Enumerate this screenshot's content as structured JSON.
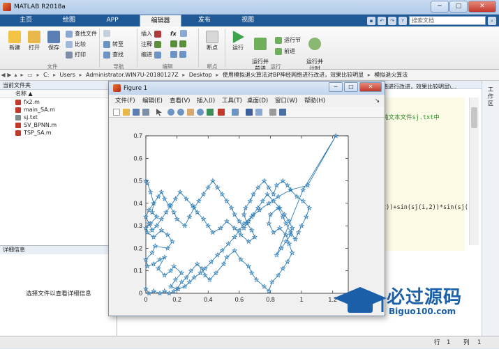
{
  "window": {
    "title": "MATLAB R2018a",
    "minimize": "─",
    "maximize": "□",
    "close": "✕"
  },
  "tabs": [
    "主页",
    "绘图",
    "APP",
    "编辑器",
    "发布",
    "视图"
  ],
  "search_placeholder": "搜索文档",
  "ribbon": {
    "new": "新建",
    "open": "打开",
    "save": "保存",
    "find_files": "查找文件",
    "compare": "比较",
    "print": "打印",
    "go_to": "转至",
    "find": "查找",
    "insert": "插入",
    "comment": "注释",
    "indent": "缩进",
    "fx": "fx",
    "breakpoints": "断点",
    "run": "运行",
    "run_advance": "运行并\n前进",
    "run_section": "运行节",
    "advance": "前进",
    "run_time": "运行并\n计时",
    "groups": {
      "file": "文件",
      "nav": "导航",
      "edit": "编辑",
      "breakpoints": "断点",
      "run": "运行"
    }
  },
  "path": [
    "C:",
    "Users",
    "Administrator.WIN7U-20180127Z",
    "Desktop",
    "使用模拟退火算法对BP神经网络进行改进，效果比较明显",
    "模拟退火算法"
  ],
  "file_panel": {
    "header": "当前文件夹",
    "col_name": "名称 ▲",
    "files": [
      {
        "name": "fx2.m",
        "color": "#c0392b"
      },
      {
        "name": "main_SA.m",
        "color": "#c0392b"
      },
      {
        "name": "sj.txt",
        "color": "#7f8c8d"
      },
      {
        "name": "SV_BPNN.m",
        "color": "#c0392b"
      },
      {
        "name": "TSP_SA.m",
        "color": "#c0392b"
      }
    ]
  },
  "details": {
    "header": "详细信息",
    "text": "选择文件以查看详细信息"
  },
  "editor": {
    "tail_path": "络进行改进，效果比较明显\\...",
    "comment_line": "纯文本文件sj.txt中",
    "code_line": "2))+sin(sj(i,2))*sin(sj("
  },
  "workspace_label": "工作区",
  "status": {
    "row_label": "行",
    "row": "1",
    "col_label": "列",
    "col": "1"
  },
  "figure": {
    "title": "Figure 1",
    "menus": [
      "文件(F)",
      "编辑(E)",
      "查看(V)",
      "插入(I)",
      "工具(T)",
      "桌面(D)",
      "窗口(W)",
      "帮助(H)"
    ]
  },
  "watermark": {
    "brand": "必过源码",
    "url": "Biguo100.com"
  },
  "chart_data": {
    "type": "line",
    "title": "",
    "xlabel": "",
    "ylabel": "",
    "xlim": [
      0,
      1.3
    ],
    "ylim": [
      0,
      0.7
    ],
    "xticks": [
      "0",
      "0.2",
      "0.4",
      "0.6",
      "0.8",
      "1",
      "1.2"
    ],
    "yticks": [
      "0",
      "0.1",
      "0.2",
      "0.3",
      "0.4",
      "0.5",
      "0.6",
      "0.7"
    ],
    "marker": "pentagram",
    "color": "#2c7bb6",
    "x": [
      0.0,
      0.01,
      0.03,
      0.05,
      0.04,
      0.07,
      0.03,
      0.0,
      0.01,
      0.05,
      0.1,
      0.14,
      0.17,
      0.14,
      0.06,
      0.04,
      0.0,
      0.01,
      0.05,
      0.09,
      0.12,
      0.08,
      0.12,
      0.16,
      0.18,
      0.23,
      0.19,
      0.16,
      0.2,
      0.23,
      0.26,
      0.29,
      0.33,
      0.36,
      0.38,
      0.41,
      0.45,
      0.5,
      0.52,
      0.57,
      0.61,
      0.66,
      0.68,
      0.71,
      0.76,
      0.79,
      0.81,
      0.85,
      0.88,
      0.91,
      0.94,
      0.92,
      0.9,
      0.86,
      0.82,
      0.79,
      0.8,
      0.85,
      0.88,
      0.9,
      0.93,
      0.96,
      0.98,
      1.0,
      1.03,
      1.05,
      1.01,
      0.97,
      0.93,
      0.91,
      0.88,
      0.84,
      0.82,
      0.79,
      0.76,
      0.72,
      0.69,
      0.67,
      0.64,
      0.63,
      0.65,
      0.68,
      0.7,
      0.66,
      0.61,
      0.57,
      0.52,
      0.48,
      0.43,
      0.4,
      0.37,
      0.33,
      0.3,
      0.26,
      0.22,
      0.19,
      0.16,
      0.13,
      0.1,
      0.07,
      0.04,
      0.02,
      0.0,
      0.02,
      0.05,
      0.08,
      0.1,
      0.12,
      0.15,
      0.18,
      0.2,
      0.25,
      0.28,
      0.31,
      0.34,
      0.37,
      0.4,
      0.43,
      0.46,
      0.49,
      0.52,
      0.55,
      0.57,
      0.6,
      0.63,
      0.66,
      0.69,
      0.72,
      0.75,
      0.78,
      0.82,
      0.86,
      0.89,
      0.92,
      0.94,
      0.93,
      0.9,
      0.87,
      0.84,
      1.01,
      1.22,
      1.04,
      0.93,
      0.85,
      0.79,
      0.73,
      0.68,
      0.63,
      0.6,
      0.57,
      0.53,
      0.49,
      0.46,
      0.42,
      0.38,
      0.35,
      0.31,
      0.28,
      0.25,
      0.21,
      0.18,
      0.15,
      0.12,
      0.09,
      0.05,
      0.02,
      0.0
    ],
    "y": [
      0.5,
      0.49,
      0.45,
      0.4,
      0.36,
      0.34,
      0.31,
      0.29,
      0.27,
      0.25,
      0.28,
      0.26,
      0.23,
      0.2,
      0.21,
      0.18,
      0.15,
      0.12,
      0.13,
      0.15,
      0.16,
      0.11,
      0.08,
      0.1,
      0.12,
      0.09,
      0.06,
      0.03,
      0.02,
      0.05,
      0.07,
      0.1,
      0.13,
      0.11,
      0.08,
      0.06,
      0.09,
      0.13,
      0.16,
      0.19,
      0.15,
      0.12,
      0.09,
      0.06,
      0.03,
      0.01,
      0.05,
      0.08,
      0.11,
      0.14,
      0.18,
      0.22,
      0.26,
      0.29,
      0.27,
      0.31,
      0.35,
      0.38,
      0.34,
      0.31,
      0.27,
      0.24,
      0.27,
      0.3,
      0.34,
      0.38,
      0.41,
      0.43,
      0.46,
      0.48,
      0.5,
      0.48,
      0.44,
      0.47,
      0.5,
      0.47,
      0.44,
      0.41,
      0.38,
      0.35,
      0.31,
      0.28,
      0.25,
      0.23,
      0.26,
      0.29,
      0.32,
      0.29,
      0.27,
      0.3,
      0.33,
      0.36,
      0.39,
      0.42,
      0.45,
      0.42,
      0.39,
      0.36,
      0.33,
      0.3,
      0.28,
      0.31,
      0.34,
      0.37,
      0.4,
      0.43,
      0.45,
      0.42,
      0.39,
      0.36,
      0.33,
      0.3,
      0.34,
      0.38,
      0.41,
      0.44,
      0.47,
      0.5,
      0.47,
      0.44,
      0.41,
      0.38,
      0.35,
      0.32,
      0.29,
      0.32,
      0.35,
      0.38,
      0.41,
      0.44,
      0.41,
      0.38,
      0.35,
      0.32,
      0.29,
      0.26,
      0.23,
      0.2,
      0.17,
      0.46,
      0.7,
      0.48,
      0.46,
      0.43,
      0.4,
      0.37,
      0.34,
      0.31,
      0.28,
      0.25,
      0.22,
      0.19,
      0.17,
      0.14,
      0.11,
      0.09,
      0.07,
      0.05,
      0.03,
      0.02,
      0.01,
      0.0,
      0.01,
      0.0,
      0.01,
      0.0,
      0.02
    ]
  }
}
